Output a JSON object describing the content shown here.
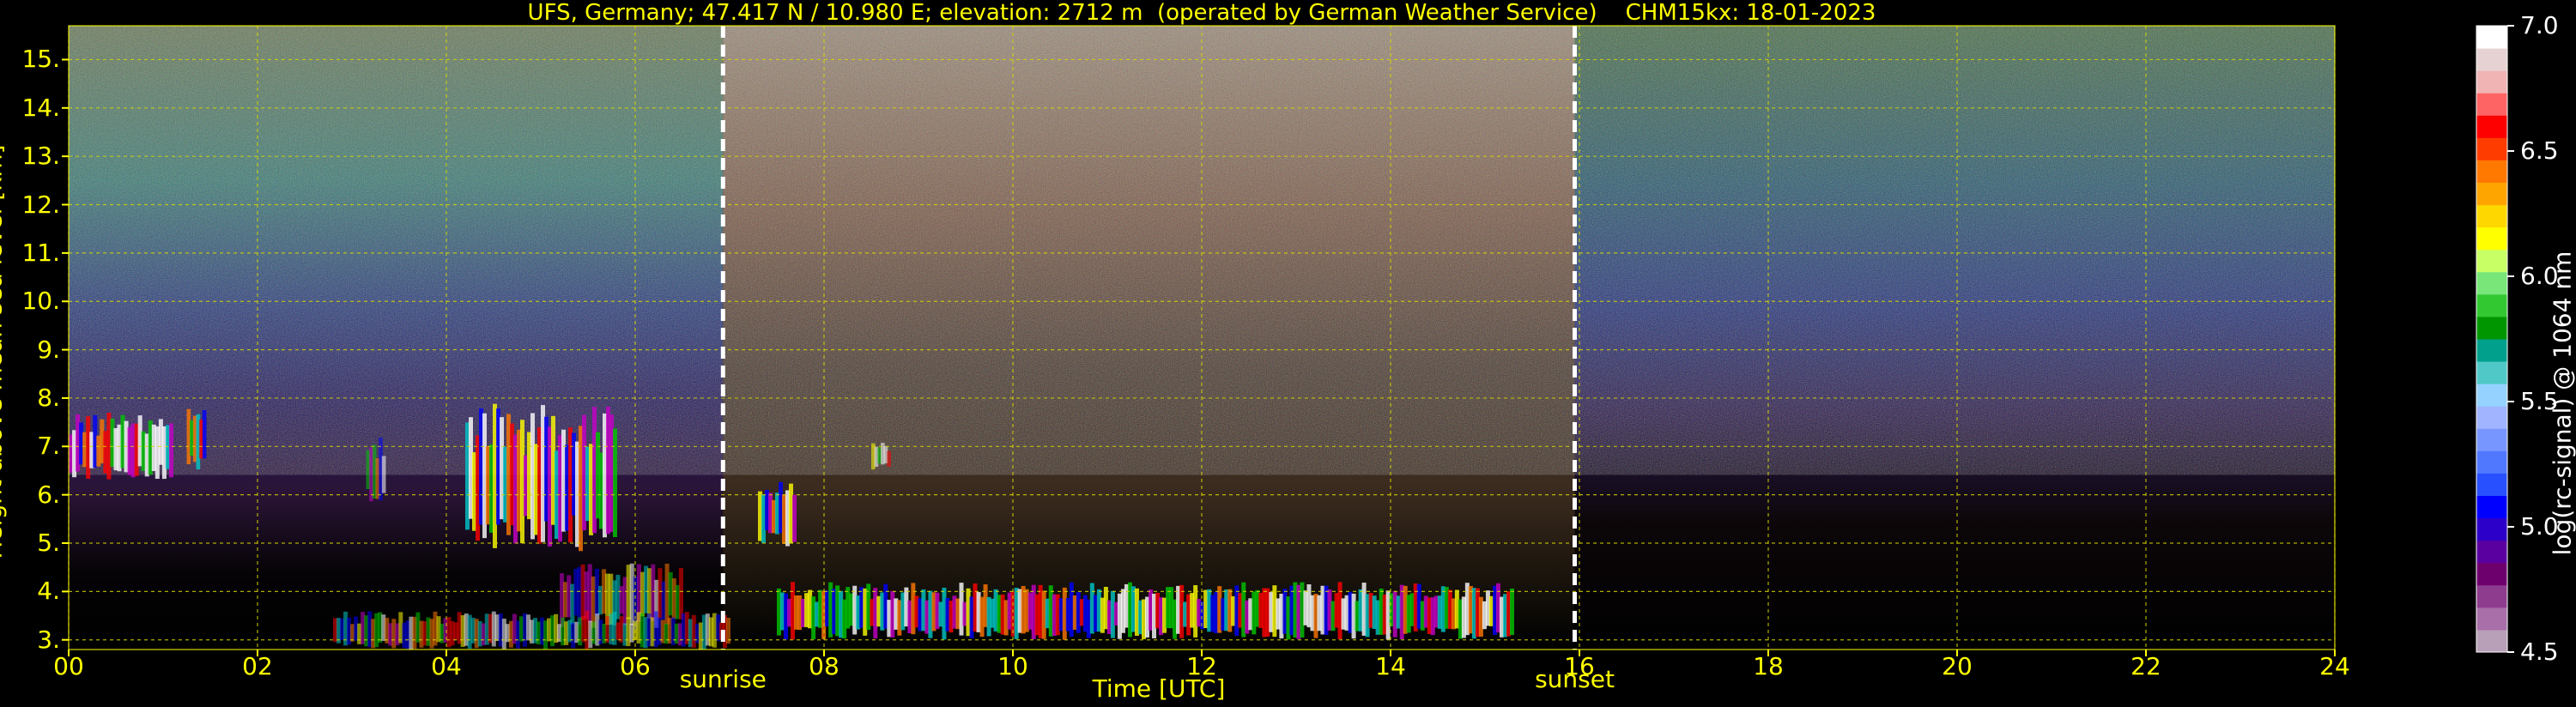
{
  "title": "UFS, Germany; 47.417 N / 10.980 E; elevation: 2712 m  (operated by German Weather Service)    CHM15kx: 18-01-2023",
  "chart_data": {
    "type": "heatmap",
    "xlabel": "Time [UTC]",
    "ylabel": "Height above mean sea level [km]",
    "xlim": [
      0,
      24
    ],
    "ylim": [
      2.8,
      15.7
    ],
    "x_ticks": [
      "00",
      "02",
      "04",
      "06",
      "08",
      "10",
      "12",
      "14",
      "16",
      "18",
      "20",
      "22",
      "24"
    ],
    "y_ticks": [
      "3.",
      "4.",
      "5.",
      "6.",
      "7.",
      "8.",
      "9.",
      "10.",
      "11.",
      "12.",
      "13.",
      "14.",
      "15."
    ],
    "grid": true,
    "events": [
      {
        "label": "sunrise",
        "x": 6.93
      },
      {
        "label": "sunset",
        "x": 15.95
      }
    ],
    "colorbar": {
      "label": "log(rc-signal) @ 1064 nm",
      "range": [
        4.5,
        7.0
      ],
      "ticks": [
        "4.5",
        "5.0",
        "5.5",
        "6.0",
        "6.5",
        "7.0"
      ],
      "colors": [
        "#b8a0b8",
        "#a86fa8",
        "#8e3c8e",
        "#6e006e",
        "#5a00a0",
        "#2c00c8",
        "#0000ff",
        "#2850ff",
        "#5078ff",
        "#7896ff",
        "#a0b4ff",
        "#96d2ff",
        "#50c8c8",
        "#00a08c",
        "#009600",
        "#32c832",
        "#78e678",
        "#c8ff64",
        "#ffff00",
        "#ffd700",
        "#ffa500",
        "#ff7800",
        "#ff3c00",
        "#ff0000",
        "#ff6464",
        "#f0b4b4",
        "#e6d2d2",
        "#ffffff"
      ]
    },
    "cloud_layers": [
      {
        "t0": 0.0,
        "t1": 1.1,
        "h0": 6.3,
        "h1": 7.7,
        "intensity": "high"
      },
      {
        "t0": 1.25,
        "t1": 1.45,
        "h0": 6.5,
        "h1": 7.8,
        "intensity": "high"
      },
      {
        "t0": 3.15,
        "t1": 3.35,
        "h0": 5.8,
        "h1": 7.2,
        "intensity": "medium"
      },
      {
        "t0": 4.2,
        "t1": 5.8,
        "h0": 4.8,
        "h1": 7.9,
        "intensity": "high"
      },
      {
        "t0": 5.2,
        "t1": 6.5,
        "h0": 3.2,
        "h1": 4.6,
        "intensity": "medium"
      },
      {
        "t0": 7.3,
        "t1": 7.7,
        "h0": 4.9,
        "h1": 6.4,
        "intensity": "high"
      },
      {
        "t0": 8.5,
        "t1": 8.7,
        "h0": 6.5,
        "h1": 7.1,
        "intensity": "medium"
      },
      {
        "t0": 7.5,
        "t1": 15.3,
        "h0": 3.0,
        "h1": 4.2,
        "intensity": "high"
      },
      {
        "t0": 2.8,
        "t1": 7.0,
        "h0": 2.8,
        "h1": 3.6,
        "intensity": "medium"
      }
    ]
  }
}
